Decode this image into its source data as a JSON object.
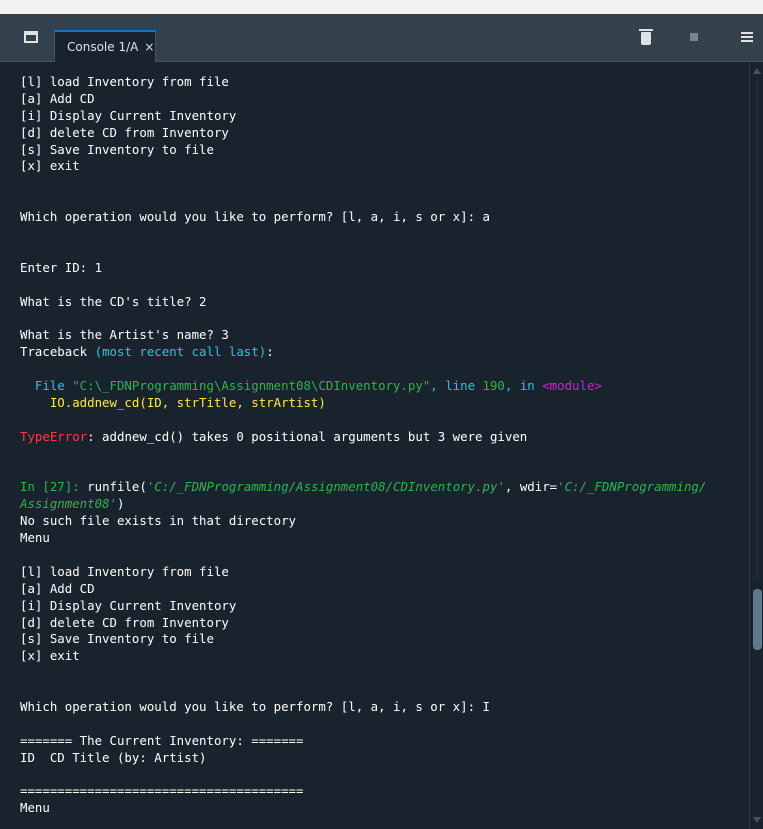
{
  "tab": {
    "label": "Console 1/A",
    "close": "×"
  },
  "toolbar": {
    "clear_icon": "trash-icon",
    "stop_icon": "stop-icon",
    "menu_icon": "hamburger-menu-icon"
  },
  "colors": {
    "background": "#19232d",
    "tabbar": "#32414b",
    "cyan": "#26c6da",
    "magenta": "#d61ed6",
    "red": "#ff3a3a",
    "green": "#30b34e",
    "yellow": "#ffeb3b"
  },
  "console": {
    "lines": [
      [
        {
          "t": "[l] load Inventory from file",
          "c": ""
        }
      ],
      [
        {
          "t": "[a] Add CD",
          "c": ""
        }
      ],
      [
        {
          "t": "[i] Display Current Inventory",
          "c": ""
        }
      ],
      [
        {
          "t": "[d] delete CD from Inventory",
          "c": ""
        }
      ],
      [
        {
          "t": "[s] Save Inventory to file",
          "c": ""
        }
      ],
      [
        {
          "t": "[x] exit",
          "c": ""
        }
      ],
      [],
      [],
      [
        {
          "t": "Which operation would you like to perform? [l, a, i, s or x]: a",
          "c": ""
        }
      ],
      [],
      [],
      [
        {
          "t": "Enter ID: 1",
          "c": ""
        }
      ],
      [],
      [
        {
          "t": "What is the CD's title? 2",
          "c": ""
        }
      ],
      [],
      [
        {
          "t": "What is the Artist's name? 3",
          "c": ""
        }
      ],
      [
        {
          "t": "Traceback ",
          "c": ""
        },
        {
          "t": "(most recent call last)",
          "c": "cyan"
        },
        {
          "t": ":",
          "c": ""
        }
      ],
      [],
      [
        {
          "t": "  File ",
          "c": "cyan"
        },
        {
          "t": "\"C:\\_FDNProgramming\\Assignment08\\CDInventory.py\"",
          "c": "green"
        },
        {
          "t": ", line ",
          "c": "cyan"
        },
        {
          "t": "190",
          "c": "green"
        },
        {
          "t": ", in ",
          "c": "cyan"
        },
        {
          "t": "<module>",
          "c": "magenta"
        }
      ],
      [
        {
          "t": "    IO.addnew_cd(ID, strTitle, strArtist)",
          "c": "yellow"
        }
      ],
      [],
      [
        {
          "t": "TypeError",
          "c": "red"
        },
        {
          "t": ": addnew_cd() takes 0 positional arguments but 3 were given",
          "c": ""
        }
      ],
      [],
      [],
      [
        {
          "t": "In [",
          "c": "green"
        },
        {
          "t": "27",
          "c": "green"
        },
        {
          "t": "]: ",
          "c": "green"
        },
        {
          "t": "runfile(",
          "c": ""
        },
        {
          "t": "'C:/_FDNProgramming/Assignment08/CDInventory.py'",
          "c": "green italic"
        },
        {
          "t": ", wdir=",
          "c": ""
        },
        {
          "t": "'C:/_FDNProgramming/",
          "c": "green italic"
        }
      ],
      [
        {
          "t": "Assignment08'",
          "c": "green italic"
        },
        {
          "t": ")",
          "c": ""
        }
      ],
      [
        {
          "t": "No such file exists in that directory",
          "c": ""
        }
      ],
      [
        {
          "t": "Menu",
          "c": ""
        }
      ],
      [],
      [
        {
          "t": "[l] load Inventory from file",
          "c": ""
        }
      ],
      [
        {
          "t": "[a] Add CD",
          "c": ""
        }
      ],
      [
        {
          "t": "[i] Display Current Inventory",
          "c": ""
        }
      ],
      [
        {
          "t": "[d] delete CD from Inventory",
          "c": ""
        }
      ],
      [
        {
          "t": "[s] Save Inventory to file",
          "c": ""
        }
      ],
      [
        {
          "t": "[x] exit",
          "c": ""
        }
      ],
      [],
      [],
      [
        {
          "t": "Which operation would you like to perform? [l, a, i, s or x]: I",
          "c": ""
        }
      ],
      [],
      [
        {
          "t": "======= The Current Inventory: =======",
          "c": ""
        }
      ],
      [
        {
          "t": "ID  CD Title (by: Artist)",
          "c": ""
        }
      ],
      [],
      [
        {
          "t": "======================================",
          "c": ""
        }
      ],
      [
        {
          "t": "Menu",
          "c": ""
        }
      ]
    ]
  }
}
